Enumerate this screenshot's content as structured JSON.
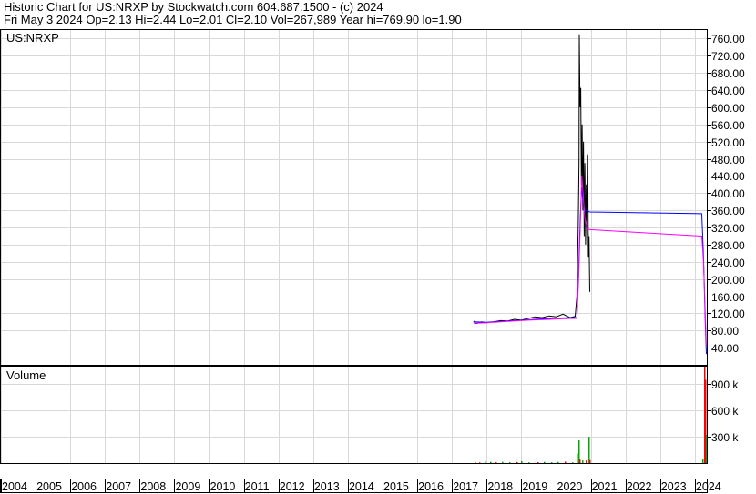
{
  "header": {
    "line1": "Historic Chart for US:NRXP by Stockwatch.com 604.687.1500 - (c) 2024",
    "line2": "Fri May  3 2024  Op=2.13  Hi=2.44  Lo=2.01  Cl=2.10  Vol=267,989  Year hi=769.90  lo=1.90"
  },
  "chart_data": {
    "type": "line",
    "symbol_label": "US:NRXP",
    "volume_label": "Volume",
    "price_axis": {
      "ticks": [
        760,
        720,
        680,
        640,
        600,
        560,
        520,
        480,
        440,
        400,
        360,
        320,
        280,
        240,
        200,
        160,
        120,
        80,
        40
      ],
      "labels": [
        "760.00",
        "720.00",
        "680.00",
        "640.00",
        "600.00",
        "560.00",
        "520.00",
        "480.00",
        "440.00",
        "400.00",
        "360.00",
        "320.00",
        "280.00",
        "240.00",
        "200.00",
        "160.00",
        "120.00",
        "80.00",
        "40.00"
      ],
      "ylim": [
        0,
        780
      ],
      "position": "right"
    },
    "volume_axis": {
      "ticks": [
        900000,
        600000,
        300000
      ],
      "labels": [
        "900 k",
        "600 k",
        "300 k"
      ],
      "ylim": [
        0,
        1100000
      ]
    },
    "x_axis": {
      "labels": [
        "2004",
        "2005",
        "2006",
        "2007",
        "2008",
        "2009",
        "2010",
        "2011",
        "2012",
        "2013",
        "2014",
        "2015",
        "2016",
        "2017",
        "2018",
        "2019",
        "2020",
        "2021",
        "2022",
        "2023",
        "2024"
      ],
      "xlim": [
        2004.0,
        2024.37
      ]
    },
    "grid": true,
    "colors": {
      "price": "#000000",
      "ma_fast": "#0000ff",
      "ma_slow": "#ff00ff",
      "bar_up": "#00aa00",
      "bar_down": "#ff0000",
      "grid": "#d8d8d8"
    },
    "price_series": [
      [
        2017.62,
        102
      ],
      [
        2017.7,
        96
      ],
      [
        2017.85,
        100
      ],
      [
        2018.0,
        98
      ],
      [
        2018.2,
        100
      ],
      [
        2018.4,
        103
      ],
      [
        2018.6,
        102
      ],
      [
        2018.8,
        106
      ],
      [
        2019.0,
        104
      ],
      [
        2019.2,
        108
      ],
      [
        2019.4,
        112
      ],
      [
        2019.6,
        110
      ],
      [
        2019.8,
        114
      ],
      [
        2020.0,
        112
      ],
      [
        2020.2,
        118
      ],
      [
        2020.4,
        110
      ],
      [
        2020.55,
        113
      ],
      [
        2020.6,
        160
      ],
      [
        2020.62,
        240
      ],
      [
        2020.64,
        330
      ],
      [
        2020.66,
        470
      ],
      [
        2020.67,
        770
      ],
      [
        2020.69,
        600
      ],
      [
        2020.71,
        645
      ],
      [
        2020.73,
        420
      ],
      [
        2020.75,
        560
      ],
      [
        2020.77,
        360
      ],
      [
        2020.79,
        520
      ],
      [
        2020.81,
        300
      ],
      [
        2020.83,
        470
      ],
      [
        2020.85,
        280
      ],
      [
        2020.87,
        420
      ],
      [
        2020.89,
        330
      ],
      [
        2020.91,
        490
      ],
      [
        2020.93,
        250
      ],
      [
        2020.95,
        300
      ],
      [
        2020.97,
        170
      ]
    ],
    "ma_fast_series": [
      [
        2017.62,
        100
      ],
      [
        2018.0,
        99
      ],
      [
        2018.6,
        102
      ],
      [
        2019.2,
        105
      ],
      [
        2019.8,
        108
      ],
      [
        2020.4,
        110
      ],
      [
        2020.6,
        110
      ],
      [
        2020.65,
        220
      ],
      [
        2020.7,
        350
      ],
      [
        2020.74,
        415
      ],
      [
        2020.78,
        380
      ],
      [
        2020.83,
        360
      ],
      [
        2020.9,
        358
      ],
      [
        2020.97,
        356
      ],
      [
        2024.2,
        352
      ],
      [
        2024.25,
        250
      ],
      [
        2024.3,
        100
      ],
      [
        2024.33,
        25
      ]
    ],
    "ma_slow_series": [
      [
        2017.62,
        97
      ],
      [
        2018.0,
        98
      ],
      [
        2018.6,
        101
      ],
      [
        2019.2,
        104
      ],
      [
        2019.8,
        106
      ],
      [
        2020.4,
        108
      ],
      [
        2020.6,
        108
      ],
      [
        2020.65,
        200
      ],
      [
        2020.7,
        330
      ],
      [
        2020.74,
        440
      ],
      [
        2020.78,
        400
      ],
      [
        2020.83,
        340
      ],
      [
        2020.9,
        318
      ],
      [
        2020.97,
        315
      ],
      [
        2024.2,
        300
      ],
      [
        2024.25,
        240
      ],
      [
        2024.3,
        120
      ],
      [
        2024.33,
        45
      ]
    ],
    "volume_series": [
      [
        2017.65,
        12000,
        "up"
      ],
      [
        2017.78,
        8000,
        "down"
      ],
      [
        2017.95,
        18000,
        "up"
      ],
      [
        2018.1,
        15000,
        "up"
      ],
      [
        2018.25,
        9000,
        "down"
      ],
      [
        2018.45,
        14000,
        "up"
      ],
      [
        2018.65,
        10000,
        "up"
      ],
      [
        2018.85,
        12000,
        "down"
      ],
      [
        2019.0,
        22000,
        "up"
      ],
      [
        2019.2,
        9000,
        "up"
      ],
      [
        2019.45,
        11000,
        "down"
      ],
      [
        2019.65,
        14000,
        "up"
      ],
      [
        2019.85,
        10000,
        "up"
      ],
      [
        2020.05,
        13000,
        "up"
      ],
      [
        2020.25,
        16000,
        "down"
      ],
      [
        2020.45,
        9000,
        "up"
      ],
      [
        2020.6,
        110000,
        "up"
      ],
      [
        2020.64,
        260000,
        "up"
      ],
      [
        2020.68,
        40000,
        "down"
      ],
      [
        2020.75,
        30000,
        "up"
      ],
      [
        2020.85,
        30000,
        "down"
      ],
      [
        2020.92,
        300000,
        "up"
      ],
      [
        2020.96,
        35000,
        "down"
      ],
      [
        2024.22,
        45000,
        "up"
      ],
      [
        2024.27,
        1100000,
        "down"
      ],
      [
        2024.3,
        950000,
        "down"
      ],
      [
        2024.33,
        320000,
        "up"
      ]
    ]
  }
}
